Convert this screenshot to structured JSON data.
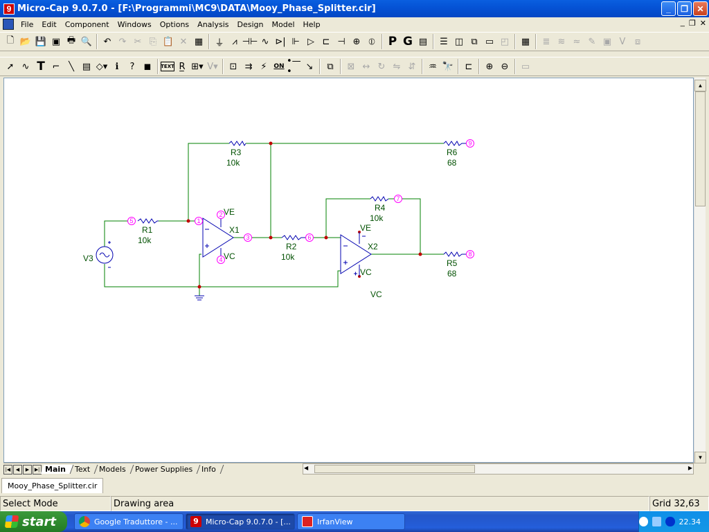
{
  "window": {
    "app_icon": "9",
    "title": "Micro-Cap 9.0.7.0 - [F:\\Programmi\\MC9\\DATA\\Mooy_Phase_Splitter.cir]",
    "controls": {
      "minimize": "_",
      "maximize": "❐",
      "close": "✕"
    }
  },
  "menu": {
    "items": [
      "File",
      "Edit",
      "Component",
      "Windows",
      "Options",
      "Analysis",
      "Design",
      "Model",
      "Help"
    ],
    "mdi_controls": {
      "minimize": "_",
      "restore": "❐",
      "close": "✕"
    }
  },
  "toolbar_row1": {
    "icons": [
      "new-icon",
      "open-icon",
      "save-icon",
      "save-all-icon",
      "print-icon",
      "print-preview-icon",
      "undo-icon",
      "redo-icon",
      "cut-icon",
      "copy-icon",
      "paste-icon",
      "delete-icon",
      "select-all-icon",
      "ground-icon",
      "resistor-icon",
      "capacitor-icon",
      "inductor-icon",
      "diode-icon",
      "bjt-icon",
      "opamp-icon",
      "mosfet-icon",
      "battery-icon",
      "source-icon",
      "current-source-icon",
      "p-key-icon",
      "g-key-icon",
      "component-editor-icon"
    ],
    "p_label": "P",
    "g_label": "G"
  },
  "toolbar_row2": {
    "text_tool_label": "TEXT",
    "on_label": "ON"
  },
  "schematic": {
    "components": {
      "R3": {
        "name": "R3",
        "value": "10k"
      },
      "R6": {
        "name": "R6",
        "value": "68"
      },
      "R1": {
        "name": "R1",
        "value": "10k"
      },
      "R2": {
        "name": "R2",
        "value": "10k"
      },
      "R4": {
        "name": "R4",
        "value": "10k"
      },
      "R5": {
        "name": "R5",
        "value": "68"
      },
      "X1": {
        "name": "X1"
      },
      "X2": {
        "name": "X2"
      },
      "V3": {
        "name": "V3"
      }
    },
    "nodes": [
      "1",
      "2",
      "3",
      "4",
      "5",
      "6",
      "7",
      "8",
      "9"
    ],
    "supply_labels": {
      "ve1": "VE",
      "vc1": "VC",
      "ve2": "VE",
      "vc2": "VC",
      "vc_free": "VC"
    },
    "wire_color": "#008000",
    "component_color": "#0000b0",
    "node_color": "#ff00ff",
    "label_color": "#005000"
  },
  "sheet_tabs": [
    "Main",
    "Text",
    "Models",
    "Power Supplies",
    "Info"
  ],
  "active_tab": "Main",
  "document_tab": "Mooy_Phase_Splitter.cir",
  "status": {
    "mode": "Select Mode",
    "area": "Drawing area",
    "grid": "Grid 32,63"
  },
  "taskbar": {
    "start_label": "start",
    "tasks": [
      "Google Traduttore - ...",
      "Micro-Cap 9.0.7.0 - [...",
      "IrfanView"
    ],
    "clock": "22.34"
  }
}
